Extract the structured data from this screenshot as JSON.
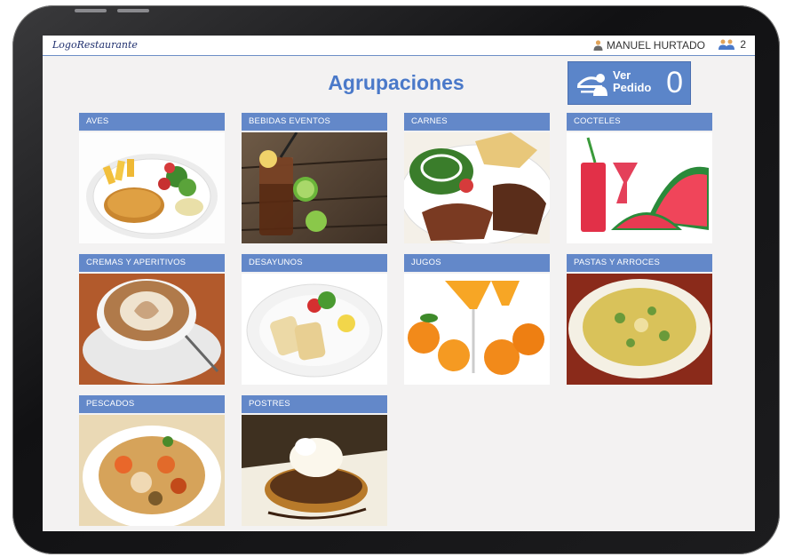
{
  "header": {
    "logo_text": "LogoRestaurante",
    "user_name": "MANUEL HURTADO",
    "group_count": "2"
  },
  "page_title": "Agrupaciones",
  "order_button": {
    "line1": "Ver",
    "line2": "Pedido",
    "count": "0",
    "color": "#5b85c9"
  },
  "categories": [
    {
      "name": "AVES",
      "image": "breaded-chicken-plate"
    },
    {
      "name": "BEBIDAS EVENTOS",
      "image": "cola-with-lime"
    },
    {
      "name": "CARNES",
      "image": "grilled-meat-with-chips"
    },
    {
      "name": "COCTELES",
      "image": "watermelon-cocktail"
    },
    {
      "name": "CREMAS Y APERITIVOS",
      "image": "cappuccino-cup"
    },
    {
      "name": "DESAYUNOS",
      "image": "breakfast-plate"
    },
    {
      "name": "JUGOS",
      "image": "orange-juice"
    },
    {
      "name": "PASTAS Y ARROCES",
      "image": "rice-pasta-dish"
    },
    {
      "name": "PESCADOS",
      "image": "fish-stew"
    },
    {
      "name": "POSTRES",
      "image": "waffle-with-ice-cream"
    }
  ],
  "colors": {
    "accent": "#4a79c9",
    "card_header": "#6388c9",
    "background": "#f3f2f2"
  }
}
